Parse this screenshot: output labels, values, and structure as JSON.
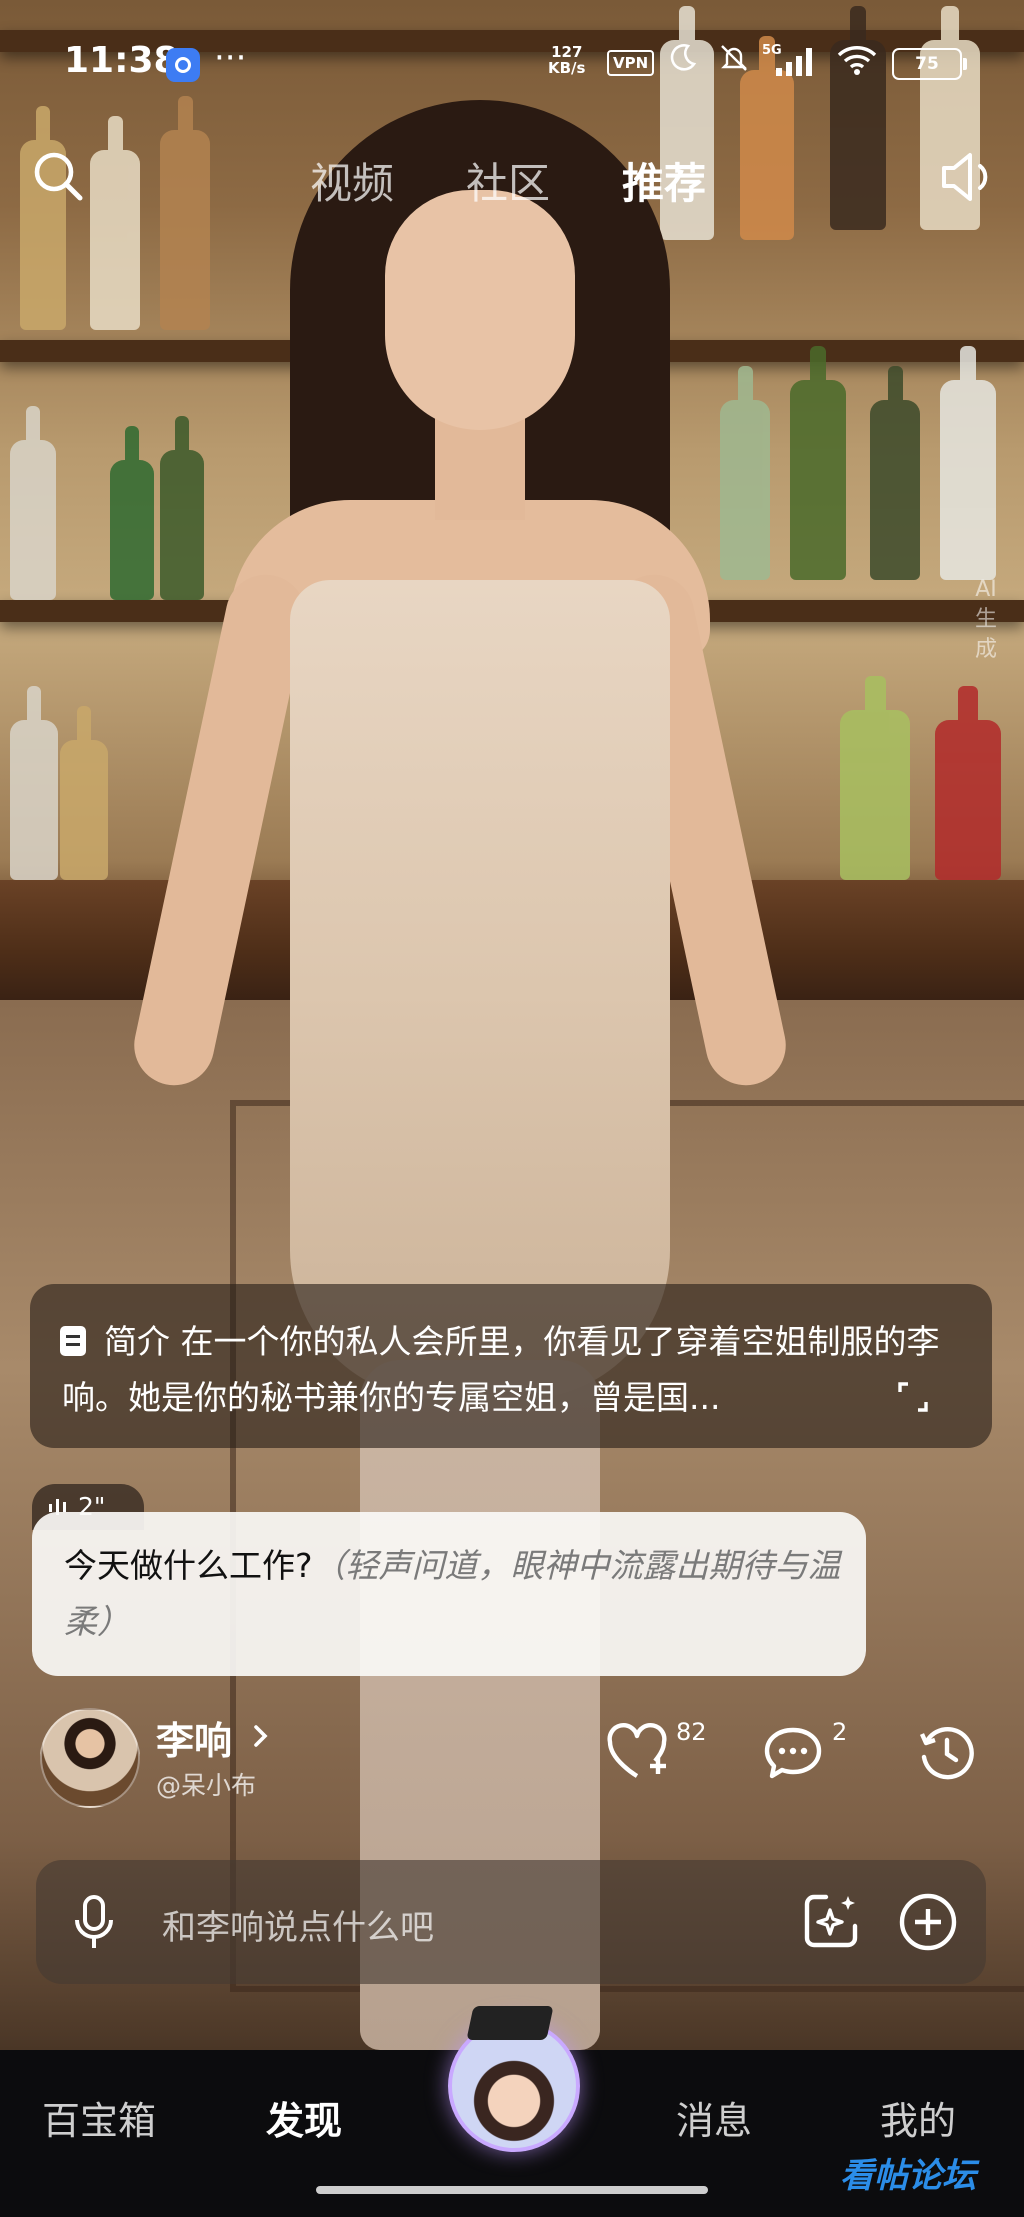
{
  "status_bar": {
    "time": "11:38",
    "dots": "···",
    "net_speed_value": "127",
    "net_speed_unit": "KB/s",
    "vpn": "VPN",
    "signal_label": "5G",
    "battery": "75"
  },
  "top_nav": {
    "tabs": [
      {
        "label": "视频",
        "active": false
      },
      {
        "label": "社区",
        "active": false
      },
      {
        "label": "推荐",
        "active": true
      }
    ]
  },
  "ai_label": "AI生成",
  "intro": {
    "label": "简介",
    "text": "在一个你的私人会所里，你看见了穿着空姐制服的李响。她是你的秘书兼你的专属空姐，曾是国..."
  },
  "voice": {
    "duration": "2\""
  },
  "message": {
    "speech": "今天做什么工作?",
    "action": "（轻声问道，眼神中流露出期待与温柔）"
  },
  "character": {
    "name": "李响",
    "handle": "@呆小布",
    "likes": "82",
    "comments": "2"
  },
  "input": {
    "placeholder": "和李响说点什么吧"
  },
  "bottom_nav": {
    "items": [
      {
        "label": "百宝箱",
        "active": false
      },
      {
        "label": "发现",
        "active": true
      },
      {
        "label": "消息",
        "active": false
      },
      {
        "label": "我的",
        "active": false
      }
    ]
  },
  "watermark": "看帖论坛",
  "colors": {
    "accent": "#c9a9ff",
    "bubble_light": "#faf8f6",
    "bottom_bar": "#0c0c0e"
  }
}
